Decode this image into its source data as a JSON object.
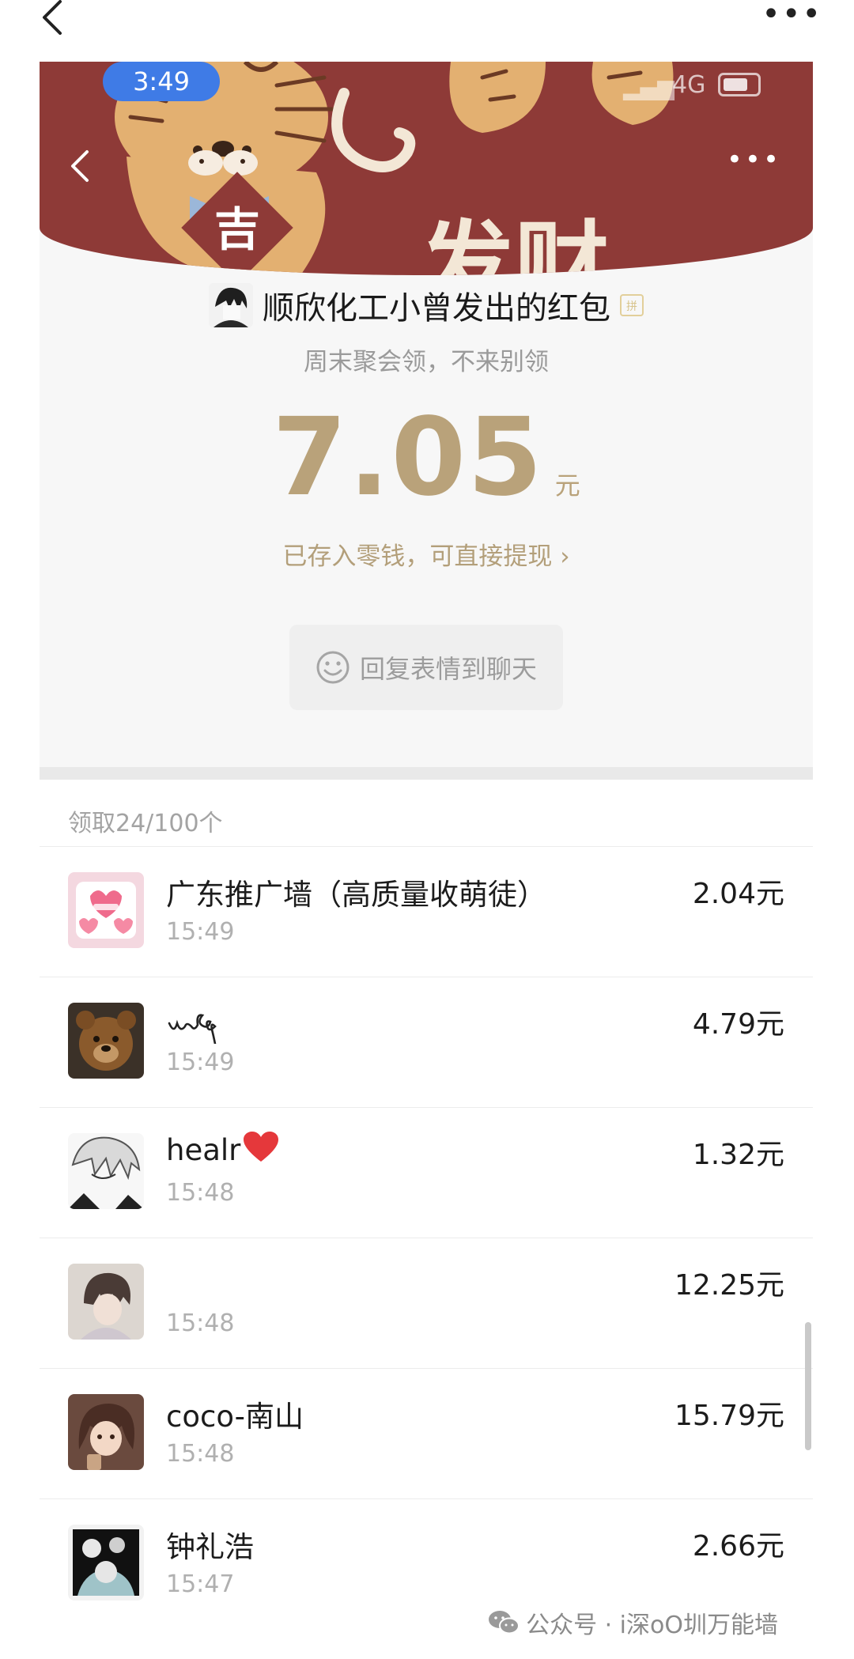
{
  "status_bar": {
    "time": "3:49",
    "network": "4G"
  },
  "banner": {
    "stamp_char": "吉",
    "headline": "发财",
    "colors": {
      "background": "#8e3a37",
      "tiger": "#e3b071"
    }
  },
  "packet": {
    "sender_title": "顺欣化工小曾发出的红包",
    "blessing": "周末聚会领，不来别领",
    "amount": "7.05",
    "unit": "元",
    "saved_text": "已存入零钱，可直接提现 ›",
    "reply_label": "回复表情到聊天",
    "pin_icon_text": "拼",
    "accent_color": "#b9a27a"
  },
  "claims": {
    "count_text": "领取24/100个",
    "rows": [
      {
        "name": "广东推广墙（高质量收萌徒）",
        "time": "15:49",
        "amount": "2.04元"
      },
      {
        "name": "",
        "time": "15:49",
        "amount": "4.79元"
      },
      {
        "name": "healr",
        "time": "15:48",
        "amount": "1.32元"
      },
      {
        "name": "",
        "time": "15:48",
        "amount": "12.25元"
      },
      {
        "name": "coco-南山",
        "time": "15:48",
        "amount": "15.79元"
      },
      {
        "name": "钟礼浩",
        "time": "15:47",
        "amount": "2.66元"
      }
    ]
  },
  "watermark": {
    "text": "公众号 · i深oO圳万能墙"
  }
}
